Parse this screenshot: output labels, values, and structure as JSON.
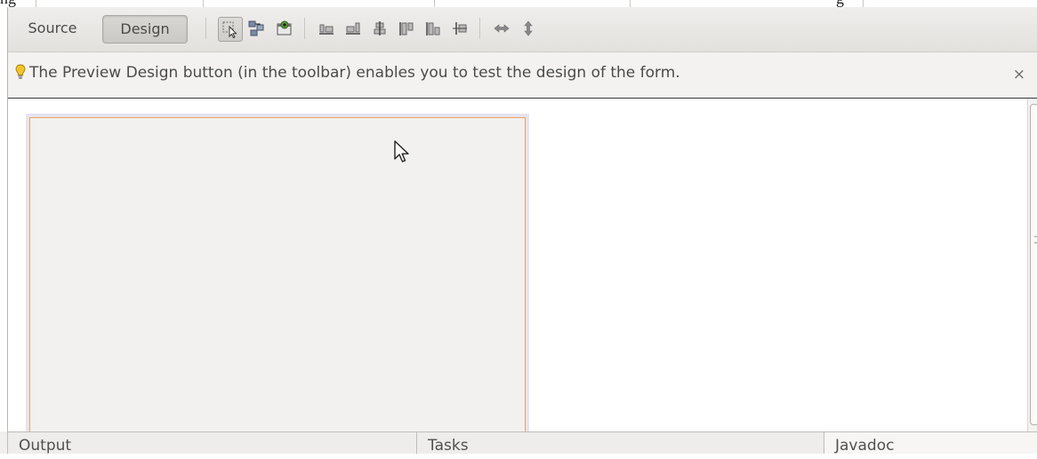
{
  "top_caption": {
    "left_text": "ng",
    "right_text": "g"
  },
  "toolbar": {
    "source_label": "Source",
    "design_label": "Design",
    "icons": [
      "selection-mode-icon",
      "connection-mode-icon",
      "preview-design-icon",
      "align-left-icon",
      "align-right-icon",
      "center-horizontally-icon",
      "align-top-icon",
      "align-bottom-icon",
      "center-vertically-icon",
      "change-horizontal-resizability-icon",
      "change-vertical-resizability-icon"
    ]
  },
  "hint": {
    "text": "The Preview Design button (in the toolbar) enables you to test the design of the form.",
    "close_label": "×"
  },
  "bottom_tabs": {
    "output": "Output",
    "tasks": "Tasks",
    "javadoc": "Javadoc"
  },
  "colors": {
    "form_border": "#f0a35c",
    "form_background": "#f2f1f0",
    "toolbar_background": "#e6e4e1"
  }
}
